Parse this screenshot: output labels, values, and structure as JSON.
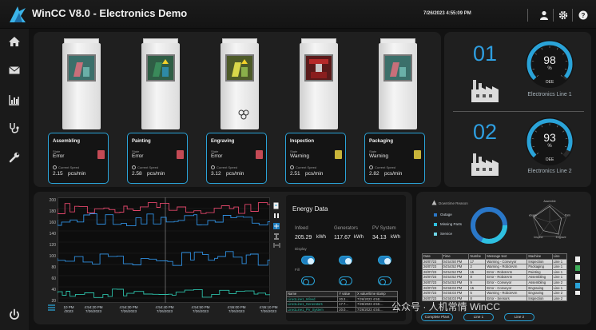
{
  "app": {
    "title": "WinCC V8.0 - Electronics Demo",
    "datetime": "7/26/2023 4:55:09 PM"
  },
  "toolbar": {
    "icons": [
      "user-icon",
      "gear-icon",
      "help-icon"
    ]
  },
  "sidebar": {
    "icons": [
      "home-icon",
      "mail-icon",
      "bar-chart-icon",
      "stethoscope-icon",
      "wrench-icon",
      "power-icon"
    ]
  },
  "stations": [
    {
      "name": "Assembling",
      "state_label": "State",
      "state": "Error",
      "speed_label": "Current Speed",
      "speed": "2.15",
      "unit": "pcs/min"
    },
    {
      "name": "Painting",
      "state_label": "State",
      "state": "Error",
      "speed_label": "Current Speed",
      "speed": "2.58",
      "unit": "pcs/min"
    },
    {
      "name": "Engraving",
      "state_label": "State",
      "state": "Error",
      "speed_label": "Current Speed",
      "speed": "3.12",
      "unit": "pcs/min"
    },
    {
      "name": "Inspection",
      "state_label": "State",
      "state": "Warning",
      "speed_label": "Current Speed",
      "speed": "2.51",
      "unit": "pcs/min"
    },
    {
      "name": "Packaging",
      "state_label": "State",
      "state": "Warning",
      "speed_label": "Current Speed",
      "speed": "2.82",
      "unit": "pcs/min"
    }
  ],
  "lines": [
    {
      "number": "01",
      "oee": "98",
      "pct": "%",
      "oee_label": "OEE",
      "name": "Electronics Line 1",
      "oee_fraction": 0.98
    },
    {
      "number": "02",
      "oee": "93",
      "pct": "%",
      "oee_label": "OEE",
      "name": "Electronics Line 2",
      "oee_fraction": 0.93
    }
  ],
  "trend": {
    "y_ticks": [
      "200",
      "180",
      "160",
      "140",
      "120",
      "100",
      "80",
      "60",
      "40",
      "20"
    ],
    "x_ticks": [
      {
        "time": "10 PM",
        "date": "/2023"
      },
      {
        "time": "4:54:20 PM",
        "date": "7/26/2023"
      },
      {
        "time": "4:54:30 PM",
        "date": "7/26/2023"
      },
      {
        "time": "4:54:40 PM",
        "date": "7/26/2023"
      },
      {
        "time": "4:54:50 PM",
        "date": "7/26/2023"
      },
      {
        "time": "4:55:00 PM",
        "date": "7/26/2023"
      },
      {
        "time": "4:55:10 PM",
        "date": "7/26/2023"
      }
    ],
    "colors": {
      "red": "#e0466a",
      "blue": "#2f8fe0",
      "teal": "#2dbfa8"
    }
  },
  "energy": {
    "title": "Energy Data",
    "columns": [
      {
        "label": "Infeed",
        "value": "205.29",
        "unit": "kWh"
      },
      {
        "label": "Generators",
        "value": "117.67",
        "unit": "kWh"
      },
      {
        "label": "PV System",
        "value": "34.13",
        "unit": "kWh"
      }
    ],
    "display_label": "Display",
    "fill_label": "Fill",
    "table": {
      "headers": [
        "Name",
        "Y value",
        "X value/time stamp"
      ],
      "rows": [
        [
          "Line1Line1_Infeed",
          "20.2...",
          "7/26/2023 4:55:..."
        ],
        [
          "Line1Line1_Generators",
          "17.7...",
          "7/26/2023 4:55:..."
        ],
        [
          "Line1Line1_PV_System",
          "20.0...",
          "7/26/2023 4:55:..."
        ]
      ]
    }
  },
  "downtime": {
    "title": "Downtime Reason",
    "legend": [
      {
        "label": "Outage",
        "color": "#2a77c8"
      },
      {
        "label": "Missing Parts",
        "color": "#2ec0e0"
      },
      {
        "label": "Service",
        "color": "#6fd6e8"
      }
    ],
    "radar_labels": [
      "Assemble",
      "Paint",
      "Engrave",
      "Inspect",
      "Package"
    ]
  },
  "alarms": {
    "headers": [
      "Date",
      "Time",
      "Numbe",
      "Message text",
      "Machine",
      "Line"
    ],
    "rows": [
      [
        "26/07/23",
        "04:54:50 PM",
        "17",
        "Warning - Conveyor",
        "Inspection",
        "Line 1"
      ],
      [
        "26/07/23",
        "04:54:52 PM",
        "2",
        "Warning - RobotArm",
        "Packaging",
        "Line 1"
      ],
      [
        "26/07/23",
        "04:54:52 PM",
        "15",
        "Error - RobotArm",
        "Painting",
        "Line 1"
      ],
      [
        "26/07/23",
        "04:54:52 PM",
        "8",
        "Error - RobotArm",
        "Assembling",
        "Line 1"
      ],
      [
        "26/07/23",
        "04:54:53 PM",
        "9",
        "Error - Conveyor",
        "Assembling",
        "Line 2"
      ],
      [
        "26/07/23",
        "04:55:03 PM",
        "15",
        "Error - Conveyor",
        "Engraving",
        "Line 1"
      ],
      [
        "26/07/23",
        "04:55:03 PM",
        "5",
        "Warning - RobotArm",
        "Engraving",
        "Line 2"
      ],
      [
        "26/07/23",
        "04:55:03 PM",
        "8",
        "Error - Sensors",
        "Inspection",
        "Line 2"
      ]
    ],
    "filter_buttons": [
      "Complete Plant",
      "Line 1",
      "Line 2"
    ]
  },
  "watermark": "公众号 · 人机常情 WinCC"
}
